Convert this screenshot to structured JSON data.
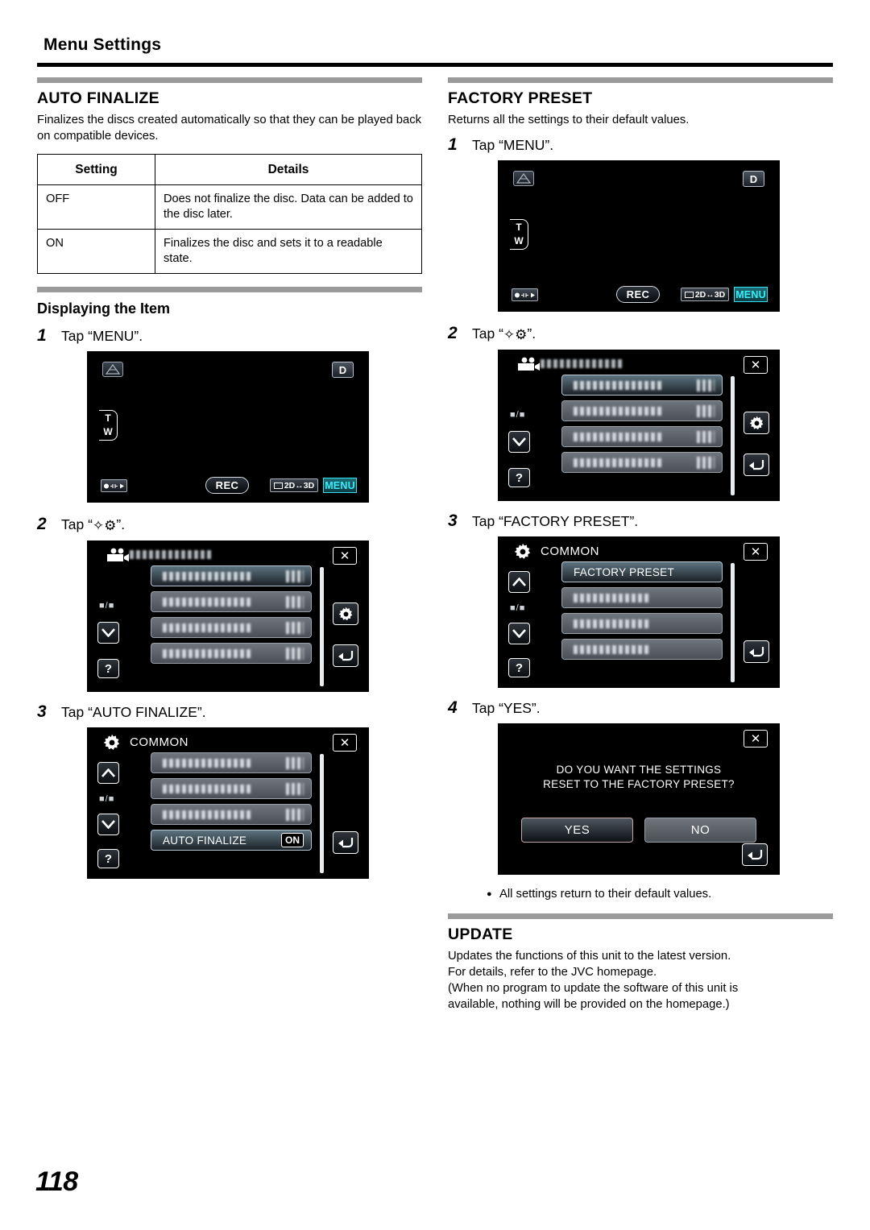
{
  "header": {
    "title": "Menu Settings"
  },
  "page": {
    "number": "118"
  },
  "left": {
    "section": {
      "heading": "AUTO FINALIZE",
      "description": "Finalizes the discs created automatically so that they can be played back on compatible devices."
    },
    "table": {
      "columns": [
        "Setting",
        "Details"
      ],
      "rows": [
        {
          "setting": "OFF",
          "details": "Does not finalize the disc. Data can be added to the disc later."
        },
        {
          "setting": "ON",
          "details": "Finalizes the disc and sets it to a readable state."
        }
      ]
    },
    "subheading": "Displaying the Item",
    "steps": [
      {
        "num": "1",
        "text": "Tap “MENU”."
      },
      {
        "num": "2",
        "text_before": "Tap “",
        "icon": "gear-icon",
        "text_after": "”."
      },
      {
        "num": "3",
        "text": "Tap “AUTO FINALIZE”."
      }
    ],
    "screens": {
      "camera": {
        "name": "camera-preview-screen",
        "icons": {
          "threed": "3d-icon",
          "disc": "D",
          "zoom_t": "T",
          "zoom_w": "W",
          "rec_play_toggle": "rec-play-toggle-icon",
          "rec": "REC",
          "twod_threed": "2D↔3D",
          "menu": "MENU"
        }
      },
      "menu_list": {
        "name": "menu-list-screen",
        "header_icon": "video-camera-icon",
        "close": "✕",
        "page_indicator": "■/■",
        "help": "?",
        "gear": "gear-icon",
        "back": "back-arrow-icon",
        "items": [
          {
            "label": "",
            "value": "",
            "selected": true
          },
          {
            "label": "",
            "value": "",
            "selected": false
          },
          {
            "label": "",
            "value": "",
            "selected": false
          },
          {
            "label": "",
            "value": "",
            "selected": false
          }
        ]
      },
      "common": {
        "name": "common-settings-screen",
        "title": "COMMON",
        "close": "✕",
        "page_indicator": "■/■",
        "help": "?",
        "back": "back-arrow-icon",
        "items": [
          {
            "label": "",
            "value": "",
            "selected": false
          },
          {
            "label": "",
            "value": "",
            "selected": false
          },
          {
            "label": "",
            "value": "",
            "selected": false
          },
          {
            "label": "AUTO FINALIZE",
            "value": "ON",
            "selected": true
          }
        ]
      }
    }
  },
  "right": {
    "section": {
      "heading": "FACTORY PRESET",
      "description": "Returns all the settings to their default values."
    },
    "steps": [
      {
        "num": "1",
        "text": "Tap “MENU”."
      },
      {
        "num": "2",
        "text_before": "Tap “",
        "icon": "gear-icon",
        "text_after": "”."
      },
      {
        "num": "3",
        "text": "Tap “FACTORY PRESET”."
      },
      {
        "num": "4",
        "text": "Tap “YES”."
      }
    ],
    "screens": {
      "camera": {
        "name": "camera-preview-screen",
        "icons": {
          "threed": "3d-icon",
          "disc": "D",
          "zoom_t": "T",
          "zoom_w": "W",
          "rec_play_toggle": "rec-play-toggle-icon",
          "rec": "REC",
          "twod_threed": "2D↔3D",
          "menu": "MENU"
        }
      },
      "menu_list": {
        "name": "menu-list-screen",
        "header_icon": "video-camera-icon",
        "close": "✕",
        "page_indicator": "■/■",
        "help": "?",
        "gear": "gear-icon",
        "back": "back-arrow-icon",
        "items": [
          {
            "label": "",
            "value": "",
            "selected": true
          },
          {
            "label": "",
            "value": "",
            "selected": false
          },
          {
            "label": "",
            "value": "",
            "selected": false
          },
          {
            "label": "",
            "value": "",
            "selected": false
          }
        ]
      },
      "common": {
        "name": "common-settings-screen",
        "title": "COMMON",
        "close": "✕",
        "page_indicator": "■/■",
        "help": "?",
        "back": "back-arrow-icon",
        "items": [
          {
            "label": "FACTORY PRESET",
            "value": "",
            "selected": true
          },
          {
            "label": "",
            "value": "",
            "selected": false
          },
          {
            "label": "",
            "value": "",
            "selected": false
          },
          {
            "label": "",
            "value": "",
            "selected": false
          }
        ]
      },
      "confirm": {
        "name": "factory-preset-confirm-dialog",
        "close": "✕",
        "message_line1": "DO YOU WANT THE SETTINGS",
        "message_line2": "RESET TO THE FACTORY PRESET?",
        "yes": "YES",
        "no": "NO",
        "back": "back-arrow-icon"
      }
    },
    "note": {
      "bullet": "●",
      "text": "All settings return to their default values."
    },
    "update": {
      "heading": "UPDATE",
      "line1": "Updates the functions of this unit to the latest version.",
      "line2": "For details, refer to the JVC homepage.",
      "line3": "(When no program to update the software of this unit is",
      "line4": "available, nothing will be provided on the homepage.)"
    }
  }
}
